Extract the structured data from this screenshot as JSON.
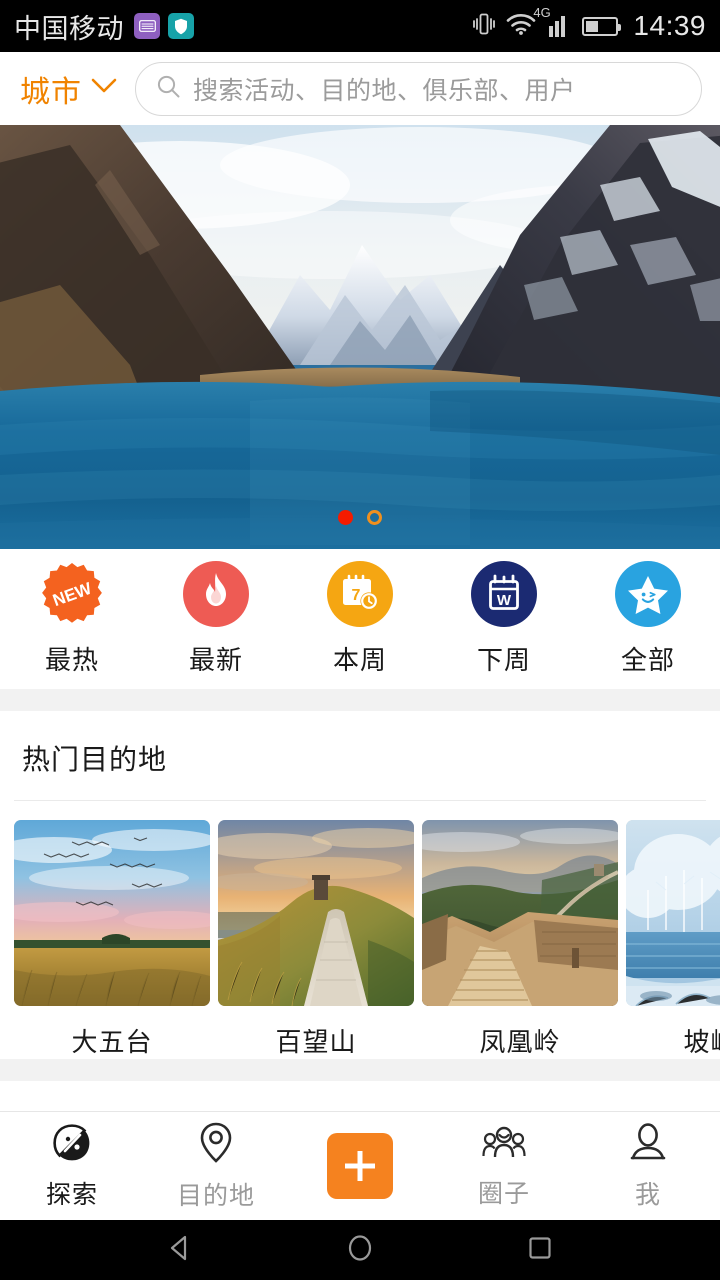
{
  "status_bar": {
    "carrier": "中国移动",
    "icons": [
      "keyboard-icon",
      "shield-icon",
      "vibrate-icon",
      "wifi-icon",
      "signal-icon",
      "battery-icon"
    ],
    "network_label": "4G",
    "battery_percent": 42,
    "time": "14:39"
  },
  "header": {
    "city_label": "城市",
    "city_chevron": "chevron-down-icon",
    "search_icon": "search-icon",
    "search_value": "",
    "search_placeholder": "搜索活动、目的地、俱乐部、用户"
  },
  "hero": {
    "alt": "雪山湖泊风景",
    "dots": [
      {
        "state": "active"
      },
      {
        "state": "idle"
      }
    ]
  },
  "categories": [
    {
      "label": "最热",
      "icon": "new-badge-icon",
      "color": "#F4621F"
    },
    {
      "label": "最新",
      "icon": "flame-icon",
      "color": "#EE5B54"
    },
    {
      "label": "本周",
      "icon": "calendar-7-clock-icon",
      "color": "#F5A612"
    },
    {
      "label": "下周",
      "icon": "calendar-w-icon",
      "color": "#1B2A72"
    },
    {
      "label": "全部",
      "icon": "star-face-icon",
      "color": "#29A3E0"
    }
  ],
  "destinations": {
    "title": "热门目的地",
    "items": [
      {
        "name": "大五台",
        "scene": "grassland-sunset"
      },
      {
        "name": "百望山",
        "scene": "hill-path-tower"
      },
      {
        "name": "凤凰岭",
        "scene": "great-wall"
      },
      {
        "name": "坡峰岭",
        "scene": "winter-frost"
      }
    ]
  },
  "tabbar": [
    {
      "label": "探索",
      "icon": "compass-icon",
      "active": true
    },
    {
      "label": "目的地",
      "icon": "location-pin-icon",
      "active": false
    },
    {
      "label": "",
      "icon": "plus-icon",
      "active": false
    },
    {
      "label": "圈子",
      "icon": "people-group-icon",
      "active": false
    },
    {
      "label": "我",
      "icon": "person-icon",
      "active": false
    }
  ],
  "android_nav": {
    "back": "back-triangle-icon",
    "home": "home-circle-icon",
    "recents": "recents-square-icon"
  }
}
